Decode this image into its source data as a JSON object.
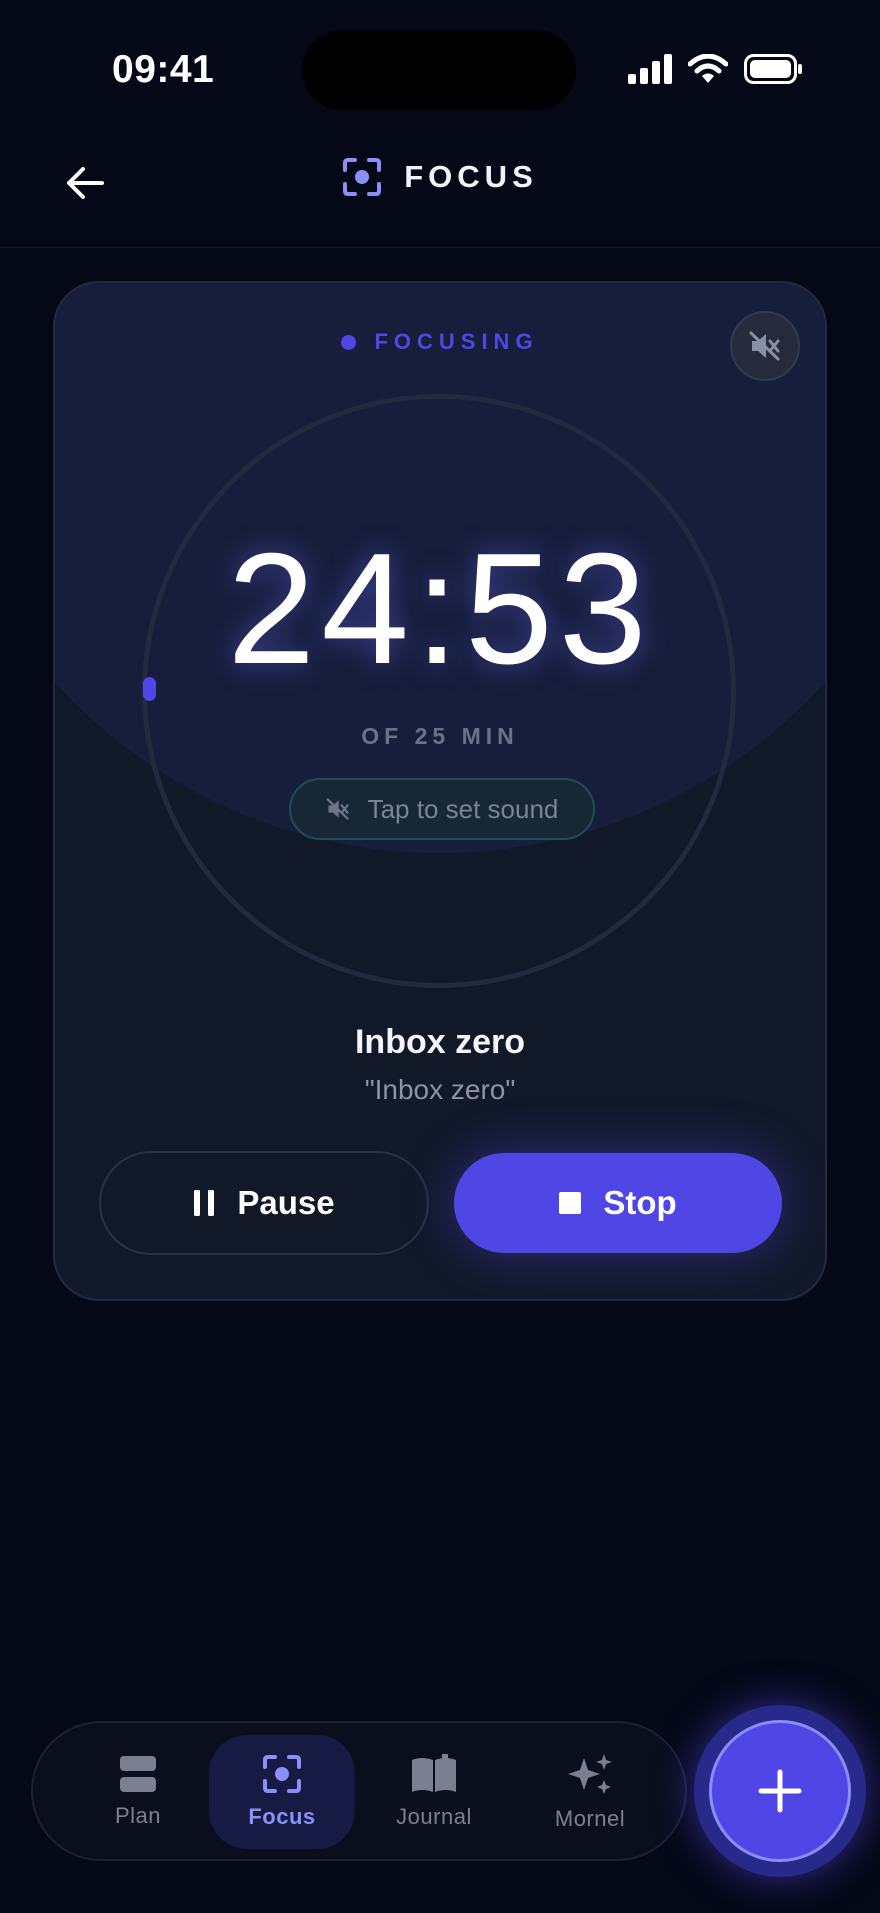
{
  "status_bar": {
    "time": "09:41"
  },
  "header": {
    "title": "FOCUS"
  },
  "timer": {
    "state_label": "FOCUSING",
    "time_remaining": "24:53",
    "duration_label": "OF 25 MIN",
    "sound_prompt": "Tap to set sound",
    "task_title": "Inbox zero",
    "task_subtitle": "\"Inbox zero\"",
    "pause_label": "Pause",
    "stop_label": "Stop"
  },
  "tabs": [
    {
      "label": "Plan",
      "icon": "plan-icon",
      "active": false
    },
    {
      "label": "Focus",
      "icon": "focus-icon",
      "active": true
    },
    {
      "label": "Journal",
      "icon": "journal-icon",
      "active": false
    },
    {
      "label": "Mornel",
      "icon": "sparkle-icon",
      "active": false
    }
  ],
  "colors": {
    "accent": "#4f46e5",
    "background": "#050816",
    "card": "#111828"
  }
}
